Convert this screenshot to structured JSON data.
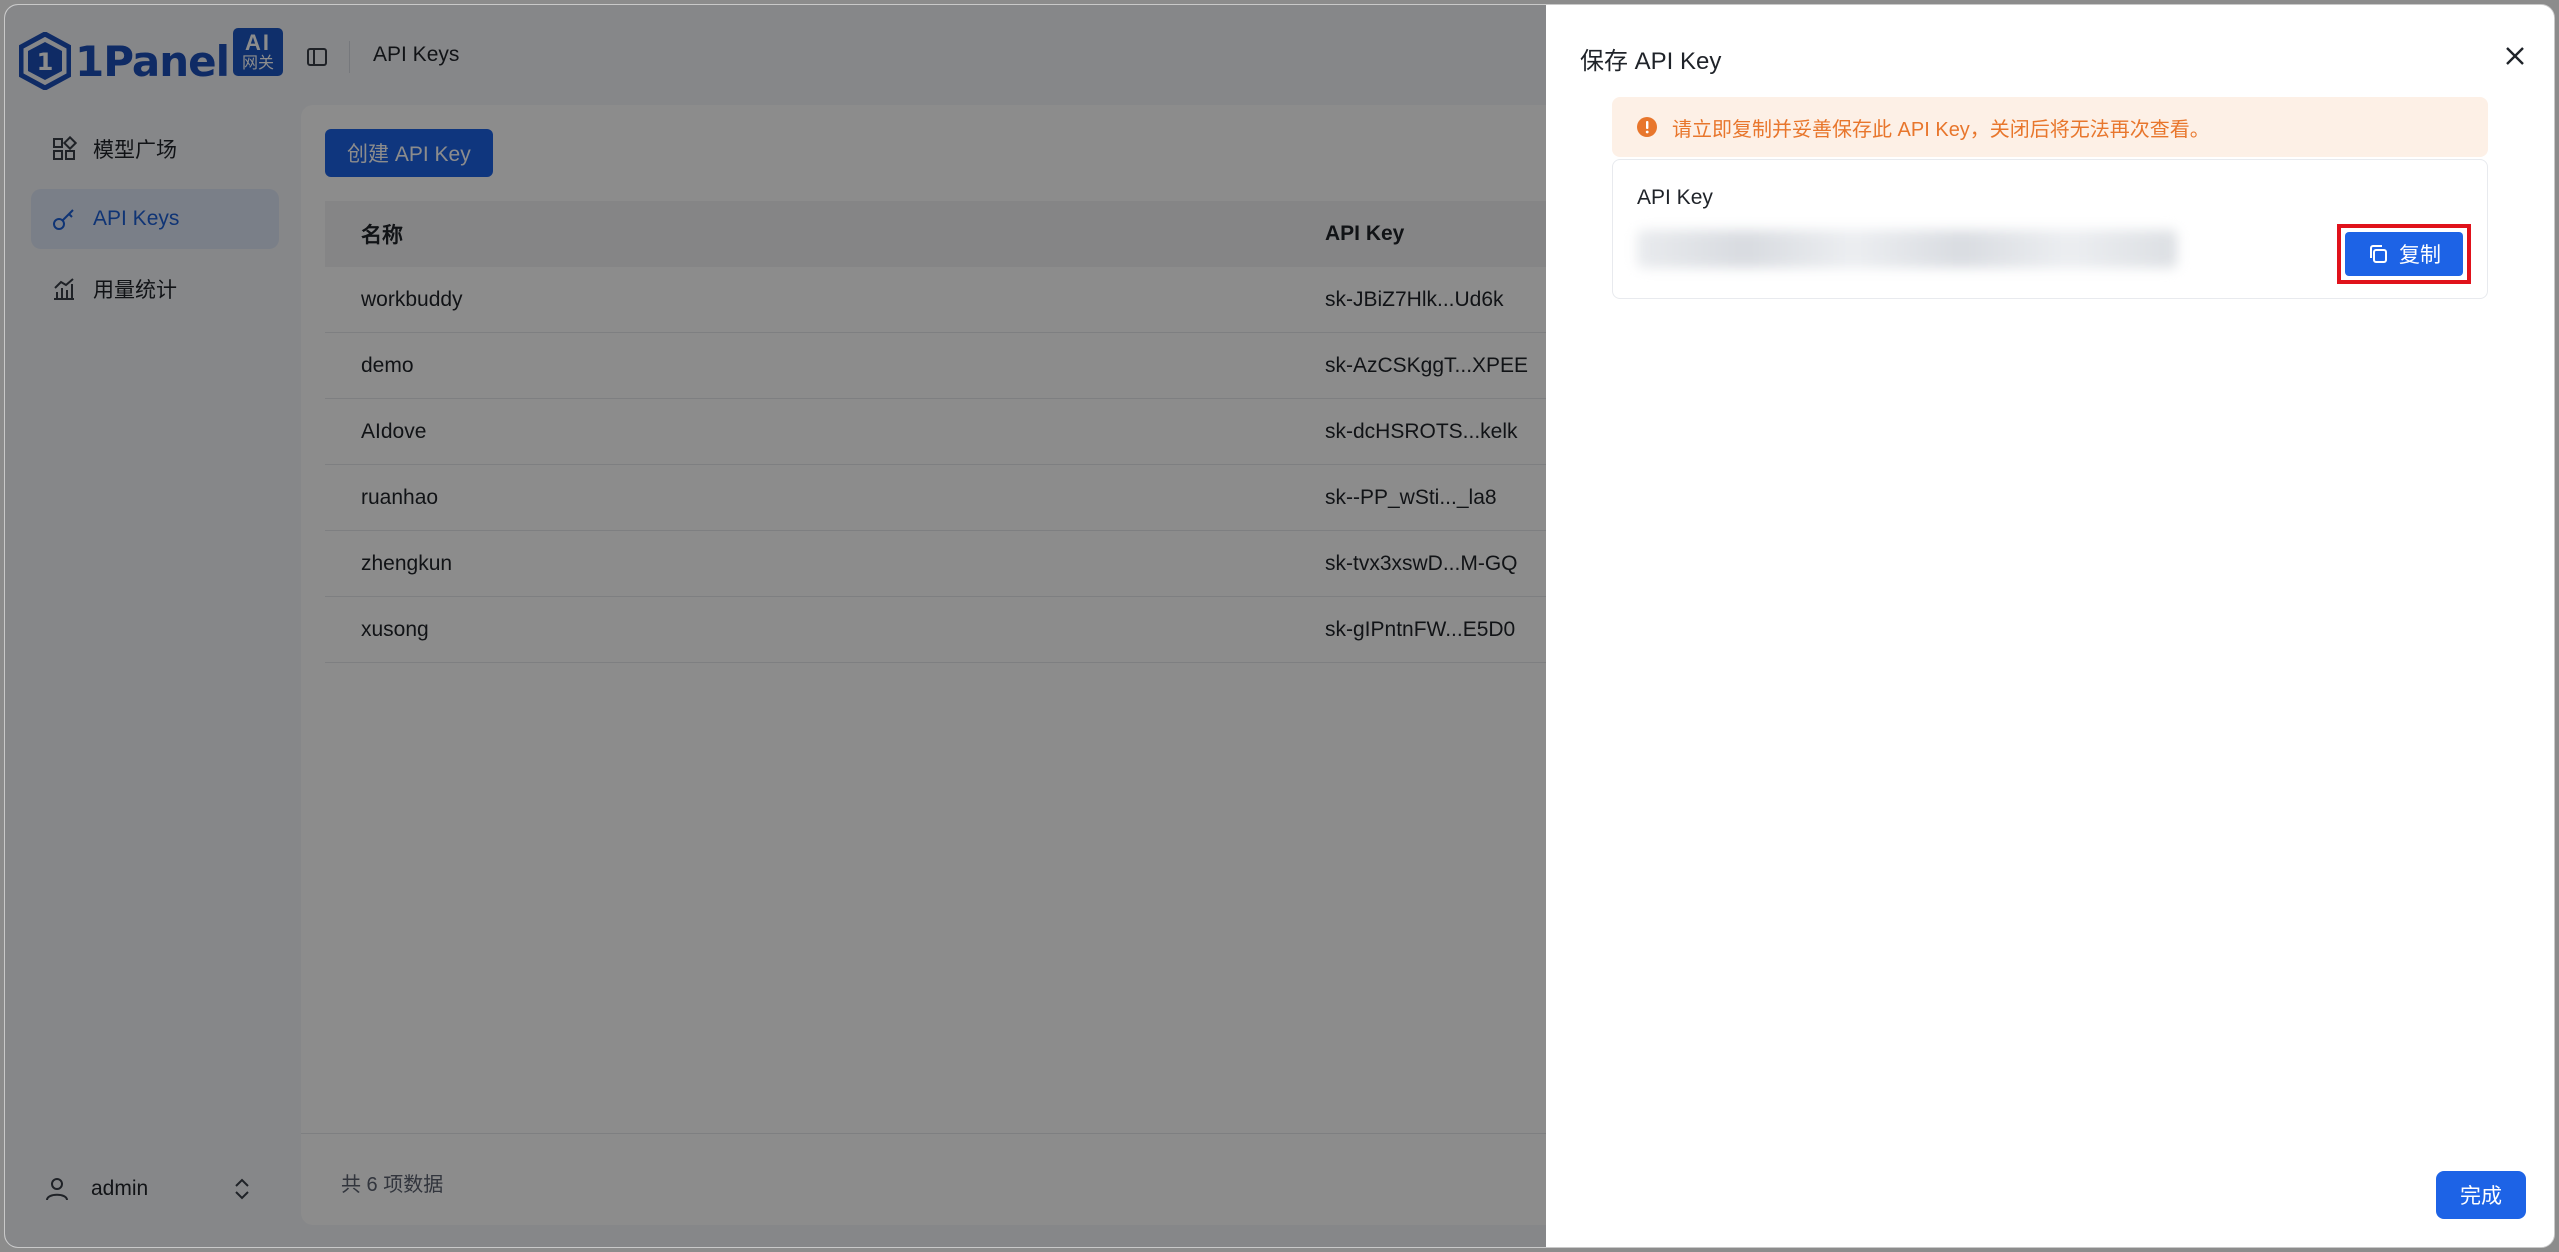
{
  "brand": {
    "name": "1Panel",
    "badge_top": "AI",
    "badge_bottom": "网关"
  },
  "breadcrumb": "API Keys",
  "sidebar": {
    "items": [
      {
        "label": "模型广场",
        "icon": "grid-icon",
        "active": false
      },
      {
        "label": "API Keys",
        "icon": "key-icon",
        "active": true
      },
      {
        "label": "用量统计",
        "icon": "bar-chart-icon",
        "active": false
      }
    ],
    "user": "admin"
  },
  "main": {
    "create_label": "创建 API Key",
    "columns": [
      "名称",
      "API Key"
    ],
    "rows": [
      {
        "name": "workbuddy",
        "key": "sk-JBiZ7Hlk...Ud6k"
      },
      {
        "name": "demo",
        "key": "sk-AzCSKggT...XPEE"
      },
      {
        "name": "AIdove",
        "key": "sk-dcHSROTS...kelk"
      },
      {
        "name": "ruanhao",
        "key": "sk--PP_wSti..._la8"
      },
      {
        "name": "zhengkun",
        "key": "sk-tvx3xswD...M-GQ"
      },
      {
        "name": "xusong",
        "key": "sk-gIPntnFW...E5D0"
      }
    ],
    "footer": "共 6 项数据"
  },
  "drawer": {
    "title": "保存 API Key",
    "alert": "请立即复制并妥善保存此 API Key，关闭后将无法再次查看。",
    "key_label": "API Key",
    "copy_label": "复制",
    "done_label": "完成"
  },
  "colors": {
    "primary": "#1d63e6",
    "warning": "#e8762c",
    "highlight": "#e0121b"
  }
}
